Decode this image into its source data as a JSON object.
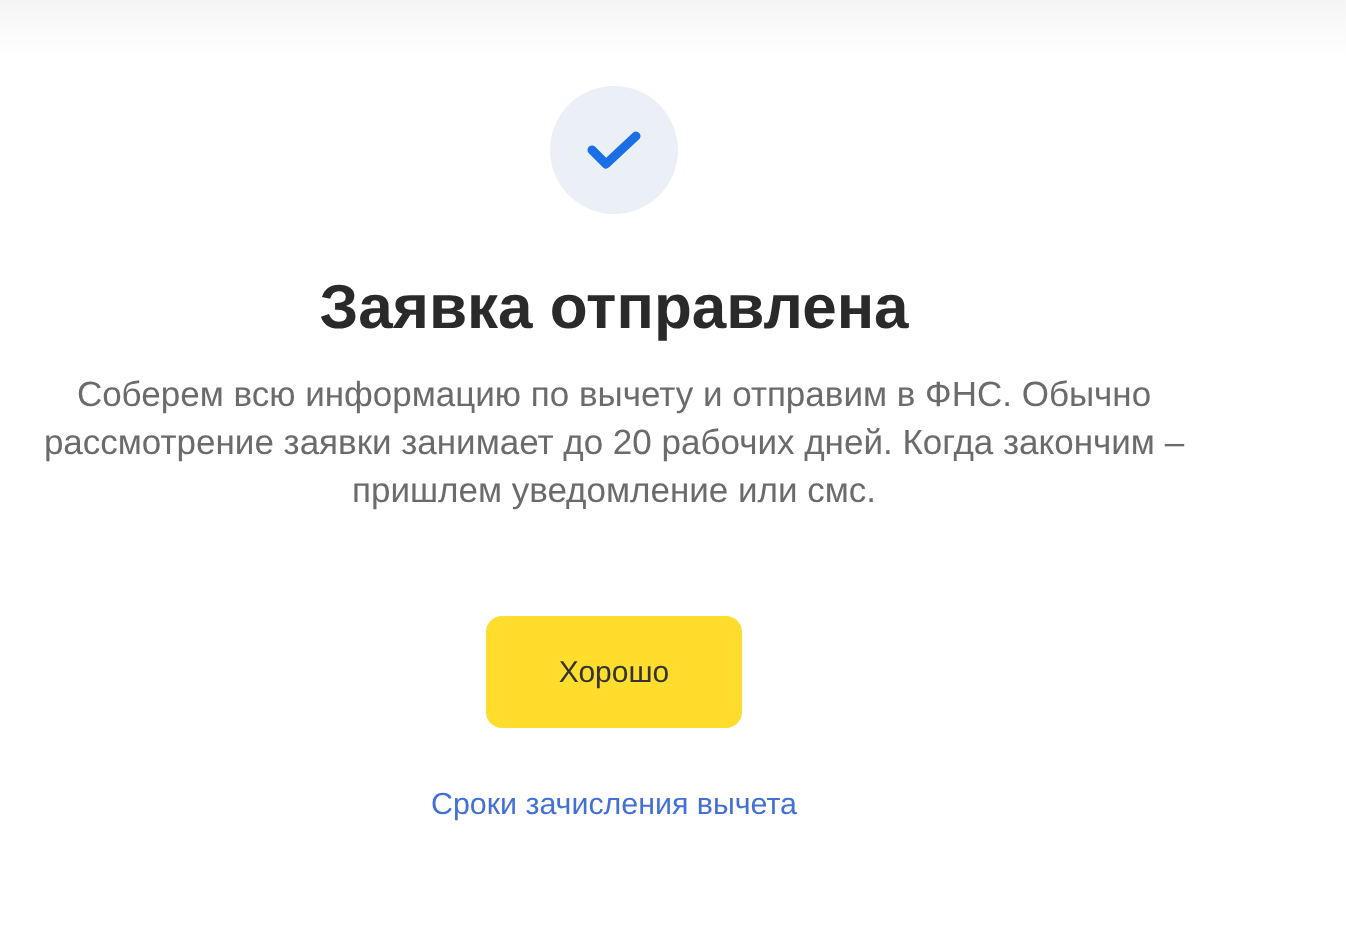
{
  "title": "Заявка отправлена",
  "message": "Соберем всю информацию по вычету и отправим в ФНС. Обычно рассмотрение заявки занимает до 20 рабочих дней. Когда закончим – пришлем уведомление или смс.",
  "button": "Хорошо",
  "link": "Сроки зачисления вычета"
}
